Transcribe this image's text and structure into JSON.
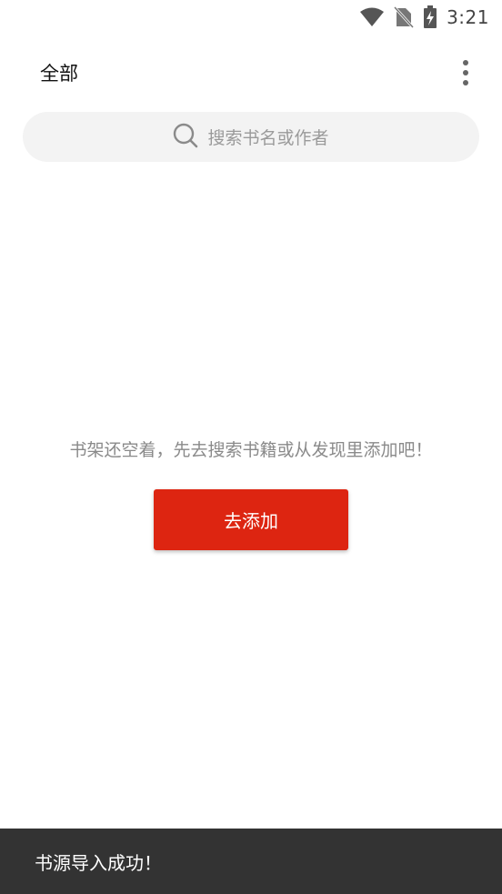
{
  "status_bar": {
    "time": "3:21",
    "icons": [
      "wifi-icon",
      "no-sim-icon",
      "battery-charging-icon"
    ]
  },
  "top_bar": {
    "title": "全部",
    "menu_icon": "more-vert-icon"
  },
  "search": {
    "placeholder": "搜索书名或作者",
    "icon": "search-icon"
  },
  "empty_state": {
    "message": "书架还空着，先去搜索书籍或从发现里添加吧！",
    "button_label": "去添加"
  },
  "snackbar": {
    "message": "书源导入成功！"
  },
  "colors": {
    "accent": "#dd2511",
    "snackbar_bg": "#333333",
    "search_bg": "#f3f3f3"
  }
}
